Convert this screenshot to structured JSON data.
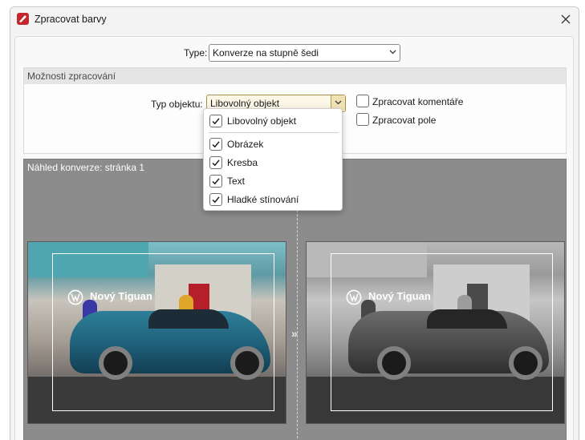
{
  "window": {
    "title": "Zpracovat barvy"
  },
  "type_row": {
    "label": "Type:",
    "value": "Konverze na stupně šedi"
  },
  "options": {
    "header": "Možnosti zpracování",
    "object_type_label": "Typ objektu:",
    "object_type_value": "Libovolný objekt",
    "process_comments": {
      "label": "Zpracovat komentáře",
      "checked": false
    },
    "process_fields": {
      "label": "Zpracovat pole",
      "checked": false
    }
  },
  "preview": {
    "header": "Náhled konverze: stránka 1",
    "caption": "Nový Tiguan",
    "between_icon": "double-chevron-right-icon"
  },
  "dropdown": {
    "items": [
      {
        "label": "Libovolný objekt",
        "checked": true
      },
      {
        "label": "Obrázek",
        "checked": true
      },
      {
        "label": "Kresba",
        "checked": true
      },
      {
        "label": "Text",
        "checked": true
      },
      {
        "label": "Hladké stínování",
        "checked": true
      }
    ]
  },
  "colors": {
    "accent": "#c4262e",
    "dropdown_highlight": "#f1e2b4",
    "check": "#1a1a1a"
  }
}
